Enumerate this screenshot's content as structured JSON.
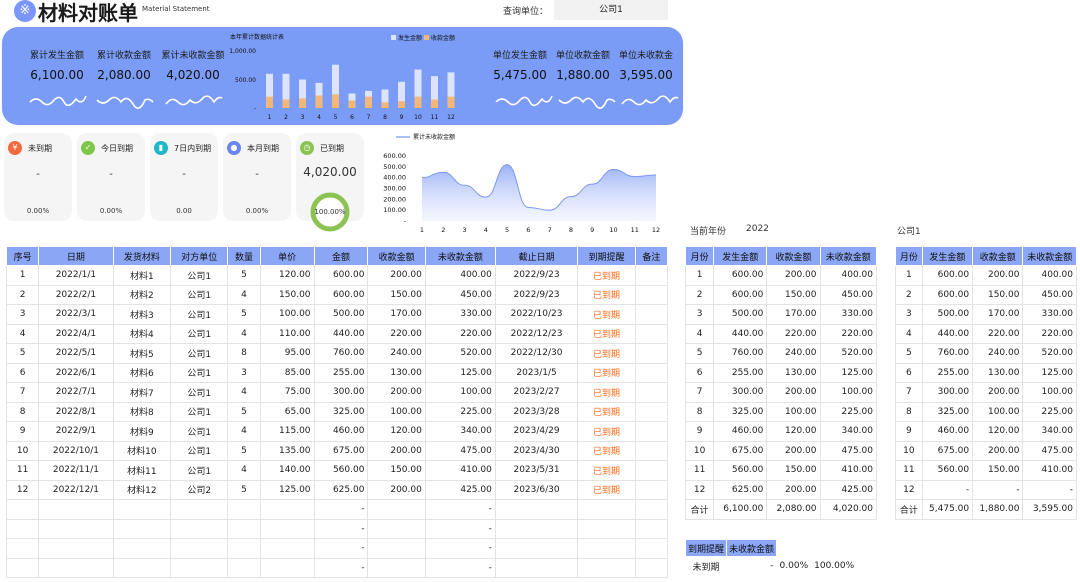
{
  "header": {
    "logo_glyph": "※",
    "title": "材料对账单",
    "subtitle": "Material Statement",
    "query_label": "查询单位：",
    "query_value": "公司1"
  },
  "kpis_left": [
    {
      "label": "累计发生金额",
      "value": "6,100.00"
    },
    {
      "label": "累计收款金额",
      "value": "2,080.00"
    },
    {
      "label": "累计未收款金额",
      "value": "4,020.00"
    }
  ],
  "kpis_right": [
    {
      "label": "单位发生金额",
      "value": "5,475.00"
    },
    {
      "label": "单位收款金额",
      "value": "1,880.00"
    },
    {
      "label": "单位未收款金",
      "value": "3,595.00"
    }
  ],
  "status_cards": [
    {
      "label": "未到期",
      "value": "-",
      "pct": "0.00%",
      "icon": "yen-icon",
      "color": "#f26a3d",
      "glyph": "¥"
    },
    {
      "label": "今日到期",
      "value": "-",
      "pct": "0.00%",
      "icon": "check-icon",
      "color": "#7cc64a",
      "glyph": "✓"
    },
    {
      "label": "7日内到期",
      "value": "-",
      "pct": "0.00",
      "icon": "bar-chart-icon",
      "color": "#1fb6c8",
      "glyph": "▮"
    },
    {
      "label": "本月到期",
      "value": "-",
      "pct": "0.00%",
      "icon": "user-icon",
      "color": "#6a86f0",
      "glyph": "●"
    },
    {
      "label": "已到期",
      "value": "4,020.00",
      "pct": "100.00%",
      "icon": "clock-icon",
      "color": "#8cc453",
      "glyph": "◷"
    }
  ],
  "chart_data": [
    {
      "type": "bar",
      "title": "本年累计数据统计表",
      "categories": [
        "1",
        "2",
        "3",
        "4",
        "5",
        "6",
        "7",
        "8",
        "9",
        "10",
        "11",
        "12"
      ],
      "series": [
        {
          "name": "发生金额",
          "values": [
            600,
            600,
            500,
            440,
            760,
            255,
            300,
            325,
            460,
            675,
            560,
            625
          ],
          "color": "#dbe4fc"
        },
        {
          "name": "收款金额",
          "values": [
            200,
            150,
            170,
            220,
            240,
            130,
            200,
            100,
            120,
            200,
            150,
            200
          ],
          "color": "#f4b77a"
        }
      ],
      "yticks": [
        "1,000.00",
        "500.00",
        "-"
      ],
      "ylim": [
        0,
        1000
      ],
      "legend": "top-right"
    },
    {
      "type": "area",
      "title": "",
      "categories": [
        "1",
        "2",
        "3",
        "4",
        "5",
        "6",
        "7",
        "8",
        "9",
        "10",
        "11",
        "12"
      ],
      "series": [
        {
          "name": "累计未收款金额",
          "values": [
            400,
            450,
            330,
            220,
            520,
            125,
            100,
            225,
            340,
            475,
            410,
            425
          ],
          "color": "#8fa8f5"
        }
      ],
      "yticks": [
        "600.00",
        "500.00",
        "400.00",
        "300.00",
        "200.00",
        "100.00",
        "-"
      ],
      "ylim": [
        0,
        600
      ],
      "legend": "top-left"
    }
  ],
  "main_table": {
    "headers": [
      "序号",
      "日期",
      "发货材料",
      "对方单位",
      "数量",
      "单价",
      "金额",
      "收款金额",
      "未收款金额",
      "截止日期",
      "到期提醒",
      "备注"
    ],
    "rows": [
      [
        "1",
        "2022/1/1",
        "材料1",
        "公司1",
        "5",
        "120.00",
        "600.00",
        "200.00",
        "400.00",
        "2022/9/23",
        "已到期",
        ""
      ],
      [
        "2",
        "2022/2/1",
        "材料2",
        "公司1",
        "4",
        "150.00",
        "600.00",
        "150.00",
        "450.00",
        "2022/9/23",
        "已到期",
        ""
      ],
      [
        "3",
        "2022/3/1",
        "材料3",
        "公司1",
        "5",
        "100.00",
        "500.00",
        "170.00",
        "330.00",
        "2022/10/23",
        "已到期",
        ""
      ],
      [
        "4",
        "2022/4/1",
        "材料4",
        "公司1",
        "4",
        "110.00",
        "440.00",
        "220.00",
        "220.00",
        "2022/12/23",
        "已到期",
        ""
      ],
      [
        "5",
        "2022/5/1",
        "材料5",
        "公司1",
        "8",
        "95.00",
        "760.00",
        "240.00",
        "520.00",
        "2022/12/30",
        "已到期",
        ""
      ],
      [
        "6",
        "2022/6/1",
        "材料6",
        "公司1",
        "3",
        "85.00",
        "255.00",
        "130.00",
        "125.00",
        "2023/1/5",
        "已到期",
        ""
      ],
      [
        "7",
        "2022/7/1",
        "材料7",
        "公司1",
        "4",
        "75.00",
        "300.00",
        "200.00",
        "100.00",
        "2023/2/27",
        "已到期",
        ""
      ],
      [
        "8",
        "2022/8/1",
        "材料8",
        "公司1",
        "5",
        "65.00",
        "325.00",
        "100.00",
        "225.00",
        "2023/3/28",
        "已到期",
        ""
      ],
      [
        "9",
        "2022/9/1",
        "材料9",
        "公司1",
        "4",
        "115.00",
        "460.00",
        "120.00",
        "340.00",
        "2023/4/29",
        "已到期",
        ""
      ],
      [
        "10",
        "2022/10/1",
        "材料10",
        "公司1",
        "5",
        "135.00",
        "675.00",
        "200.00",
        "475.00",
        "2023/4/30",
        "已到期",
        ""
      ],
      [
        "11",
        "2022/11/1",
        "材料11",
        "公司1",
        "4",
        "140.00",
        "560.00",
        "150.00",
        "410.00",
        "2023/5/31",
        "已到期",
        ""
      ],
      [
        "12",
        "2022/12/1",
        "材料12",
        "公司2",
        "5",
        "125.00",
        "625.00",
        "200.00",
        "425.00",
        "2023/6/30",
        "已到期",
        ""
      ],
      [
        "",
        "",
        "",
        "",
        "",
        "",
        "-",
        "",
        "-",
        "",
        "",
        ""
      ],
      [
        "",
        "",
        "",
        "",
        "",
        "",
        "-",
        "",
        "-",
        "",
        "",
        ""
      ],
      [
        "",
        "",
        "",
        "",
        "",
        "",
        "-",
        "",
        "-",
        "",
        "",
        ""
      ],
      [
        "",
        "",
        "",
        "",
        "",
        "",
        "-",
        "",
        "-",
        "",
        "",
        ""
      ]
    ]
  },
  "year_label": "当前年份",
  "year_value": "2022",
  "company_label": "公司1",
  "month_table": {
    "headers": [
      "月份",
      "发生金额",
      "收款金额",
      "未收款金额"
    ],
    "rows": [
      [
        "1",
        "600.00",
        "200.00",
        "400.00"
      ],
      [
        "2",
        "600.00",
        "150.00",
        "450.00"
      ],
      [
        "3",
        "500.00",
        "170.00",
        "330.00"
      ],
      [
        "4",
        "440.00",
        "220.00",
        "220.00"
      ],
      [
        "5",
        "760.00",
        "240.00",
        "520.00"
      ],
      [
        "6",
        "255.00",
        "130.00",
        "125.00"
      ],
      [
        "7",
        "300.00",
        "200.00",
        "100.00"
      ],
      [
        "8",
        "325.00",
        "100.00",
        "225.00"
      ],
      [
        "9",
        "460.00",
        "120.00",
        "340.00"
      ],
      [
        "10",
        "675.00",
        "200.00",
        "475.00"
      ],
      [
        "11",
        "560.00",
        "150.00",
        "410.00"
      ],
      [
        "12",
        "625.00",
        "200.00",
        "425.00"
      ],
      [
        "合计",
        "6,100.00",
        "2,080.00",
        "4,020.00"
      ]
    ]
  },
  "company_table": {
    "headers": [
      "月份",
      "发生金额",
      "收款金额",
      "未收款金额"
    ],
    "rows": [
      [
        "1",
        "600.00",
        "200.00",
        "400.00"
      ],
      [
        "2",
        "600.00",
        "150.00",
        "450.00"
      ],
      [
        "3",
        "500.00",
        "170.00",
        "330.00"
      ],
      [
        "4",
        "440.00",
        "220.00",
        "220.00"
      ],
      [
        "5",
        "760.00",
        "240.00",
        "520.00"
      ],
      [
        "6",
        "255.00",
        "130.00",
        "125.00"
      ],
      [
        "7",
        "300.00",
        "200.00",
        "100.00"
      ],
      [
        "8",
        "325.00",
        "100.00",
        "225.00"
      ],
      [
        "9",
        "460.00",
        "120.00",
        "340.00"
      ],
      [
        "10",
        "675.00",
        "200.00",
        "475.00"
      ],
      [
        "11",
        "560.00",
        "150.00",
        "410.00"
      ],
      [
        "12",
        "-",
        "-",
        "-"
      ],
      [
        "合计",
        "5,475.00",
        "1,880.00",
        "3,595.00"
      ]
    ]
  },
  "due_table": {
    "headers": [
      "到期提醒",
      "未收款金额"
    ],
    "rows": [
      [
        "未到期",
        "-",
        "0.00%",
        "100.00%"
      ]
    ]
  }
}
